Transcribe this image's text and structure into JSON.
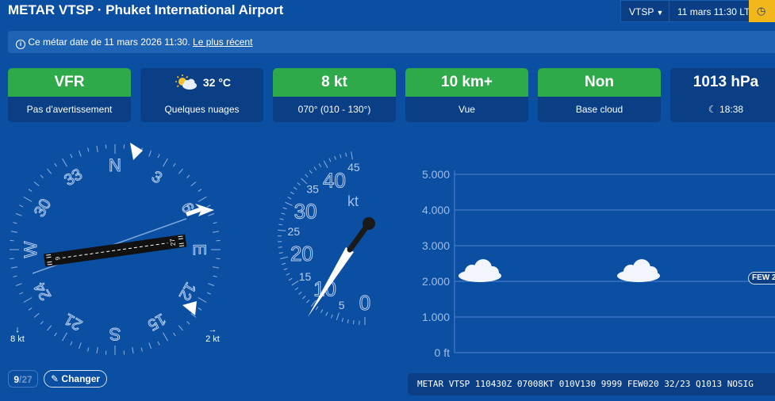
{
  "header": {
    "title": "METAR VTSP · Phuket International Airport",
    "station_select": "VTSP",
    "datetime": "11 mars 11:30 LT"
  },
  "notice": {
    "text": "Ce métar date de 11 mars 2026 11:30.",
    "link": "Le plus récent"
  },
  "cards": {
    "flight_rules": {
      "value": "VFR",
      "label": "Pas d'avertissement",
      "color": "#2eaa4a"
    },
    "weather": {
      "value": "32 °C",
      "label": "Quelques nuages",
      "icon": "partly-cloudy-icon"
    },
    "wind": {
      "value": "8 kt",
      "label": "070° (010 - 130°)",
      "color": "#2eaa4a"
    },
    "visibility": {
      "value": "10 km+",
      "label": "Vue",
      "color": "#2eaa4a"
    },
    "ceiling": {
      "value": "Non",
      "label": "Base cloud",
      "color": "#2eaa4a"
    },
    "pressure": {
      "value": "1013 hPa",
      "label": "18:38",
      "icon": "moon-icon"
    }
  },
  "compass": {
    "heading_labels": [
      "N",
      "3",
      "6",
      "E",
      "12",
      "15",
      "S",
      "21",
      "24",
      "W",
      "30",
      "33"
    ],
    "runway_ends": [
      "6",
      "27"
    ],
    "wind_from_deg": 70,
    "variable_range_deg": [
      10,
      130
    ],
    "left_wind": "8 kt",
    "right_wind": "2 kt"
  },
  "speed_gauge": {
    "unit": "kt",
    "major_ticks": [
      "0",
      "10",
      "20",
      "30",
      "40"
    ],
    "minor_ticks": [
      "5",
      "15",
      "25",
      "35",
      "45"
    ],
    "value": 8,
    "gust_max": 45
  },
  "cloud_chart": {
    "type": "bar",
    "y_ticks": [
      "5.000",
      "4.000",
      "3.000",
      "2.000",
      "1.000",
      "0 ft"
    ],
    "ylim": [
      0,
      5000
    ],
    "layers": [
      {
        "cover": "FEW",
        "base_ft": 2000,
        "label": "FEW 2"
      }
    ]
  },
  "metar_raw": "METAR VTSP 110430Z 07008KT 010V130 9999 FEW020 32/23 Q1013 NOSIG",
  "footer": {
    "page_current": "9",
    "page_total": "/27",
    "change_label": "Changer"
  },
  "chart_data": {
    "type": "bar",
    "categories": [
      "FEW"
    ],
    "values": [
      2000
    ],
    "title": "",
    "xlabel": "",
    "ylabel": "",
    "ylim": [
      0,
      5000
    ]
  }
}
